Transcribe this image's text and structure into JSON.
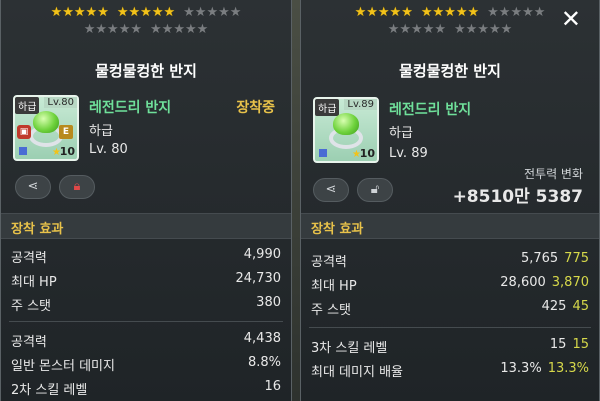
{
  "left": {
    "stars": {
      "row1": [
        "on",
        "on",
        "on",
        "on",
        "on",
        "on",
        "on",
        "on",
        "on",
        "on",
        "off",
        "off",
        "off",
        "off",
        "off"
      ],
      "row2": [
        "off",
        "off",
        "off",
        "off",
        "off",
        "off",
        "off",
        "off",
        "off",
        "off"
      ]
    },
    "title": "물컹물컹한 반지",
    "icon": {
      "grade": "하급",
      "level": "Lv.80",
      "lock": "🔒",
      "equip_mark": "E",
      "star": "★",
      "count": "10"
    },
    "item_name": "레전드리 반지",
    "equipped": "장착중",
    "grade": "하급",
    "level": "Lv. 80",
    "buttons": {
      "share": "share-icon",
      "lock": "lock-icon"
    },
    "section": "장착 효과",
    "stats": [
      {
        "label": "공격력",
        "value": "4,990"
      },
      {
        "label": "최대 HP",
        "value": "24,730"
      },
      {
        "label": "주 스탯",
        "value": "380"
      }
    ],
    "extra_stats": [
      {
        "label": "공격력",
        "value": "4,438"
      },
      {
        "label": "일반 몬스터 데미지",
        "value": "8.8%"
      },
      {
        "label": "2차 스킬 레벨",
        "value": "16"
      }
    ]
  },
  "right": {
    "stars": {
      "row1": [
        "on",
        "on",
        "on",
        "on",
        "on",
        "on",
        "on",
        "on",
        "on",
        "on",
        "off",
        "off",
        "off",
        "off",
        "off"
      ],
      "row2": [
        "off",
        "off",
        "off",
        "off",
        "off",
        "off",
        "off",
        "off",
        "off",
        "off"
      ]
    },
    "close_label": "✕",
    "title": "물컹물컹한 반지",
    "icon": {
      "grade": "하급",
      "level": "Lv.89",
      "star": "★",
      "count": "10"
    },
    "item_name": "레전드리 반지",
    "grade": "하급",
    "level": "Lv. 89",
    "power_label": "전투력 변화",
    "power_value": "+8510만 5387",
    "section": "장착 효과",
    "stats": [
      {
        "label": "공격력",
        "value": "5,765",
        "bonus": "775"
      },
      {
        "label": "최대 HP",
        "value": "28,600",
        "bonus": "3,870"
      },
      {
        "label": "주 스탯",
        "value": "425",
        "bonus": "45"
      }
    ],
    "extra_stats": [
      {
        "label": "3차 스킬 레벨",
        "value": "15",
        "bonus": "15"
      },
      {
        "label": "최대 데미지 배율",
        "value": "13.3%",
        "bonus": "13.3%"
      }
    ]
  },
  "colors": {
    "star_on": "#f2c21a",
    "star_off": "#7a7d80",
    "legendary_name": "#6fe09a",
    "section_label": "#e8c24a",
    "bonus": "#d6d84a"
  }
}
